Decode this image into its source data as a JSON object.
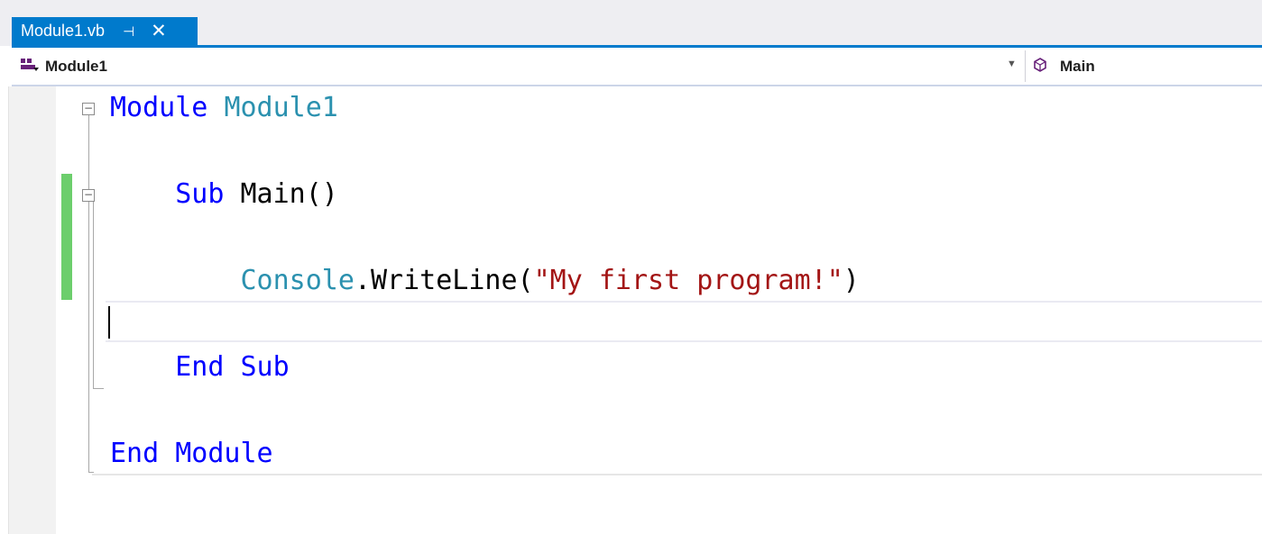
{
  "tab": {
    "title": "Module1.vb",
    "pin_glyph": "⊣",
    "close_glyph": "✕"
  },
  "navbar": {
    "left": {
      "icon": "module-icon",
      "label": "Module1"
    },
    "right": {
      "icon": "method-icon",
      "label": "Main"
    }
  },
  "editor": {
    "lines": [
      {
        "tokens": [
          {
            "t": "kw",
            "v": "Module"
          },
          {
            "t": "plain",
            "v": " "
          },
          {
            "t": "type",
            "v": "Module1"
          }
        ]
      },
      {
        "tokens": []
      },
      {
        "tokens": [
          {
            "t": "plain",
            "v": "    "
          },
          {
            "t": "kw",
            "v": "Sub"
          },
          {
            "t": "plain",
            "v": " Main()"
          }
        ]
      },
      {
        "tokens": []
      },
      {
        "tokens": [
          {
            "t": "plain",
            "v": "        "
          },
          {
            "t": "type",
            "v": "Console"
          },
          {
            "t": "plain",
            "v": ".WriteLine("
          },
          {
            "t": "str",
            "v": "\"My first program!\""
          },
          {
            "t": "plain",
            "v": ")"
          }
        ]
      },
      {
        "tokens": []
      },
      {
        "tokens": [
          {
            "t": "plain",
            "v": "    "
          },
          {
            "t": "kw",
            "v": "End Sub"
          }
        ]
      },
      {
        "tokens": []
      },
      {
        "tokens": [
          {
            "t": "kw",
            "v": "End Module"
          }
        ]
      }
    ],
    "current_line": 6,
    "colors": {
      "keyword": "#0000ff",
      "type": "#2b91af",
      "string": "#a31515",
      "change_bar": "#6cce6c",
      "accent": "#007acc"
    }
  }
}
